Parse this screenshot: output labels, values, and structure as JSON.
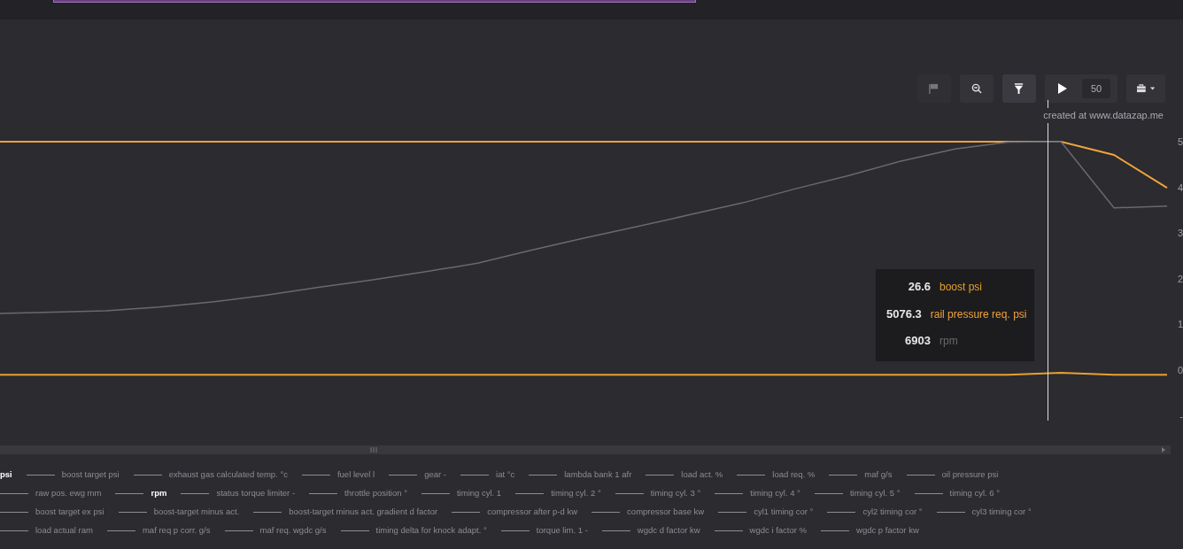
{
  "toolbar": {
    "buttons": [
      {
        "kind": "flag",
        "disabled": true
      },
      {
        "kind": "zoom-out",
        "disabled": false
      },
      {
        "kind": "filter",
        "disabled": false
      }
    ],
    "play": {
      "value": "50"
    },
    "menu": {
      "kind": "briefcase"
    }
  },
  "chart": {
    "credit": "created at www.datazap.me",
    "chart_data": {
      "type": "line",
      "ylim": [
        -1,
        5
      ],
      "yticks": [
        5,
        4,
        3,
        2,
        1,
        0,
        {
          "value": -1,
          "label": "-"
        }
      ],
      "series": [
        {
          "name": "boost psi",
          "color": "#e8a030",
          "values": [
            -0.1,
            -0.1,
            -0.1,
            -0.1,
            -0.1,
            -0.1,
            -0.1,
            -0.1,
            -0.1,
            -0.1,
            -0.1,
            -0.1,
            -0.1,
            -0.1,
            -0.1,
            -0.1,
            -0.1,
            -0.1,
            -0.1,
            -0.1,
            -0.06,
            -0.1,
            -0.1
          ]
        },
        {
          "name": "rail pressure req. psi",
          "color": "#f0a23c",
          "values": [
            5,
            5,
            5,
            5,
            5,
            5,
            5,
            5,
            5,
            5,
            5,
            5,
            5,
            5,
            5,
            5,
            5,
            5,
            5,
            5,
            5,
            4.71,
            3.99
          ]
        },
        {
          "name": "rpm",
          "color": "#6a6a6e",
          "values": [
            1.24,
            1.27,
            1.3,
            1.38,
            1.49,
            1.64,
            1.81,
            1.97,
            2.15,
            2.34,
            2.62,
            2.89,
            3.14,
            3.4,
            3.66,
            3.97,
            4.26,
            4.58,
            4.84,
            4.99,
            5.0,
            3.55,
            3.59
          ]
        }
      ]
    },
    "tooltip": [
      "26.6",
      "5076.3",
      "6903"
    ]
  },
  "legend": [
    [
      {
        "label": "psi",
        "active": true,
        "line": false
      },
      {
        "label": "boost target psi",
        "active": false,
        "line": true
      },
      {
        "label": "exhaust gas calculated temp. °c",
        "active": false,
        "line": true
      },
      {
        "label": "fuel level l",
        "active": false,
        "line": true
      },
      {
        "label": "gear -",
        "active": false,
        "line": true
      },
      {
        "label": "iat °c",
        "active": false,
        "line": true
      },
      {
        "label": "lambda bank 1 afr",
        "active": false,
        "line": true
      },
      {
        "label": "load act. %",
        "active": false,
        "line": true
      },
      {
        "label": "load req. %",
        "active": false,
        "line": true
      },
      {
        "label": "maf g/s",
        "active": false,
        "line": true
      },
      {
        "label": "oil pressure psi",
        "active": false,
        "line": true
      }
    ],
    [
      {
        "label": "raw pos. ewg mm",
        "active": false,
        "line": true
      },
      {
        "label": "rpm",
        "active": true,
        "line": true
      },
      {
        "label": "status torque limiter -",
        "active": false,
        "line": true
      },
      {
        "label": "throttle position °",
        "active": false,
        "line": true
      },
      {
        "label": "timing cyl. 1",
        "active": false,
        "line": true
      },
      {
        "label": "timing cyl. 2 °",
        "active": false,
        "line": true
      },
      {
        "label": "timing cyl. 3 °",
        "active": false,
        "line": true
      },
      {
        "label": "timing cyl. 4 °",
        "active": false,
        "line": true
      },
      {
        "label": "timing cyl. 5 °",
        "active": false,
        "line": true
      },
      {
        "label": "timing cyl. 6 °",
        "active": false,
        "line": true
      }
    ],
    [
      {
        "label": "boost target ex psi",
        "active": false,
        "line": true
      },
      {
        "label": "boost-target minus act.",
        "active": false,
        "line": true
      },
      {
        "label": "boost-target minus act. gradient d factor",
        "active": false,
        "line": true
      },
      {
        "label": "compressor after p-d kw",
        "active": false,
        "line": true
      },
      {
        "label": "compressor base kw",
        "active": false,
        "line": true
      },
      {
        "label": "cyl1 timing cor °",
        "active": false,
        "line": true
      },
      {
        "label": "cyl2 timing cor °",
        "active": false,
        "line": true
      },
      {
        "label": "cyl3 timing cor °",
        "active": false,
        "line": true
      }
    ],
    [
      {
        "label": "load actual ram",
        "active": false,
        "line": true
      },
      {
        "label": "maf req p corr. g/s",
        "active": false,
        "line": true
      },
      {
        "label": "maf req. wgdc g/s",
        "active": false,
        "line": true
      },
      {
        "label": "timing delta for knock adapt. °",
        "active": false,
        "line": true
      },
      {
        "label": "torque lim. 1 -",
        "active": false,
        "line": true
      },
      {
        "label": "wgdc d factor kw",
        "active": false,
        "line": true
      },
      {
        "label": "wgdc i factor %",
        "active": false,
        "line": true
      },
      {
        "label": "wgdc p factor kw",
        "active": false,
        "line": true
      }
    ]
  ]
}
